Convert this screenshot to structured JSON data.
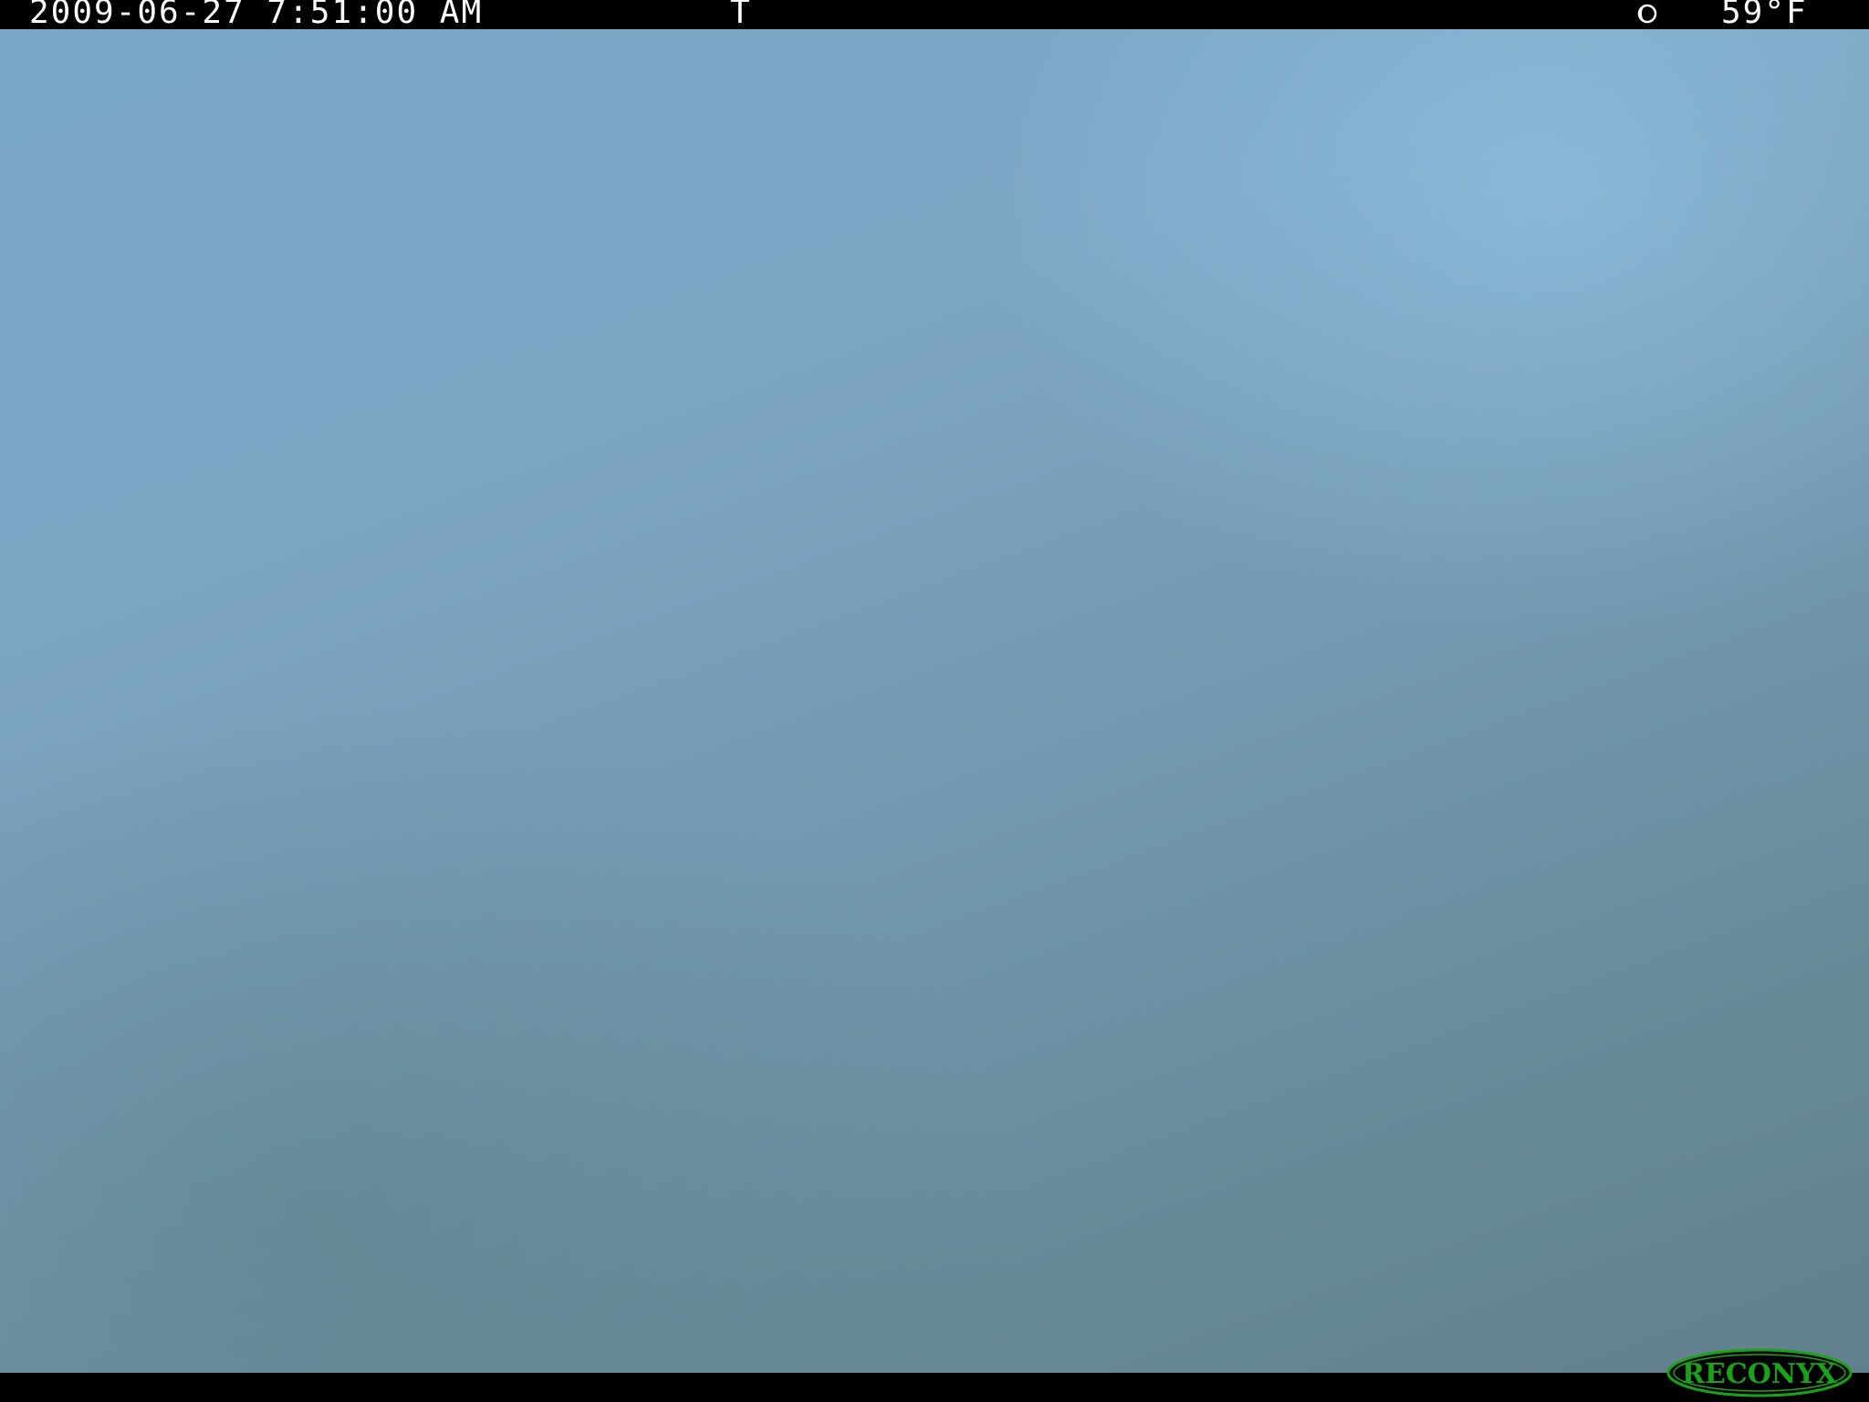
{
  "overlay": {
    "timestamp": "2009-06-27 7:51:00 AM",
    "trigger_code": "T",
    "moon_phase_icon": "moon-phase-icon",
    "temperature": "59°F"
  },
  "logo": {
    "brand": "RECONYX",
    "color": "#1aa21a"
  },
  "colors": {
    "sky_light": "#93c3e6",
    "sky_mid": "#7aa6c8",
    "sky_dark": "#627f8d",
    "bar": "#000000",
    "overlay_text": "#ffffff"
  }
}
